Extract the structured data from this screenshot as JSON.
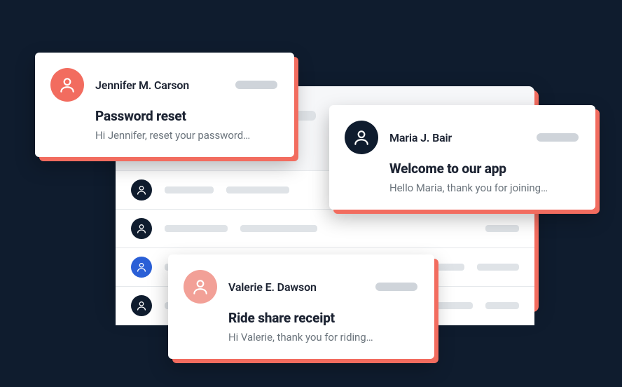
{
  "cards": {
    "jennifer": {
      "sender": "Jennifer M. Carson",
      "subject": "Password reset",
      "preview": "Hi Jennifer, reset your password…"
    },
    "maria": {
      "sender": "Maria J. Bair",
      "subject": "Welcome to our app",
      "preview": "Hello Maria, thank you for joining…"
    },
    "valerie": {
      "sender": "Valerie E. Dawson",
      "subject": "Ride share receipt",
      "preview": "Hi Valerie, thank you for riding…"
    }
  }
}
